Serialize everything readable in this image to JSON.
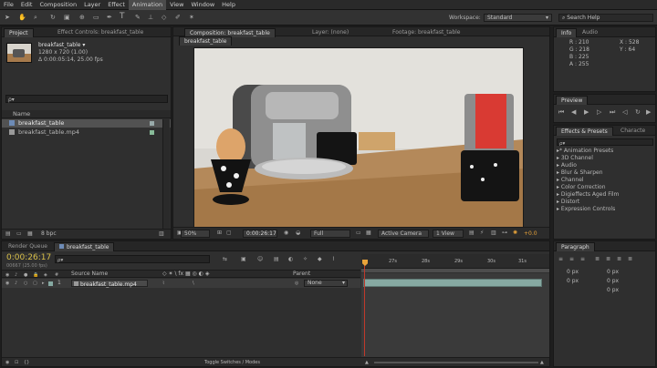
{
  "menu": {
    "items": [
      "File",
      "Edit",
      "Composition",
      "Layer",
      "Effect",
      "Animation",
      "View",
      "Window",
      "Help"
    ],
    "hover_index": 5
  },
  "toolbar": {
    "workspace_label": "Workspace:",
    "workspace_value": "Standard",
    "search_placeholder": "Search Help"
  },
  "project": {
    "tab_project": "Project",
    "tab_effect_controls": "Effect Controls: breakfast_table",
    "preview_name": "breakfast_table ▾",
    "preview_size": "1280 x 720 (1.00)",
    "preview_duration": "Δ 0:00:05:14, 25.00 fps",
    "col_name": "Name",
    "items": [
      {
        "name": "breakfast_table",
        "selected": true
      },
      {
        "name": "breakfast_table.mp4",
        "selected": false
      }
    ],
    "bpc": "8 bpc"
  },
  "composition": {
    "tab_comp": "Composition: breakfast_table",
    "tab_layer": "Layer: (none)",
    "tab_footage": "Footage: breakfast_table",
    "sub_tab": "breakfast_table",
    "zoom": "50%",
    "timecode": "0:00:26:17",
    "resolution": "Full",
    "camera": "Active Camera",
    "views": "1 View",
    "exposure": "+0.0"
  },
  "info": {
    "tab_info": "Info",
    "tab_audio": "Audio",
    "r": "R : 210",
    "g": "G : 218",
    "b": "B : 225",
    "a": "A : 255",
    "x": "X : 528",
    "y": "Y : 64"
  },
  "preview": {
    "tab": "Preview"
  },
  "effects": {
    "tab": "Effects & Presets",
    "tab2": "Characte",
    "search_placeholder": "ρ▾",
    "items": [
      "* Animation Presets",
      "3D Channel",
      "Audio",
      "Blur & Sharpen",
      "Channel",
      "Color Correction",
      "Digieffects Aged Film",
      "Distort",
      "Expression Controls"
    ]
  },
  "timeline": {
    "tab_render": "Render Queue",
    "tab_comp": "breakfast_table",
    "timecode": "0:00:26:17",
    "frame_info": "00667 (25.00 fps)",
    "search_placeholder": "ρ▾",
    "col_source": "Source Name",
    "col_parent": "Parent",
    "layer_num": "1",
    "layer_name": "breakfast_table.mp4",
    "parent_value": "None",
    "ruler": [
      "27s",
      "28s",
      "29s",
      "30s",
      "31s"
    ],
    "toggle_label": "Toggle Switches / Modes",
    "playhead_fraction": 0.0
  },
  "paragraph": {
    "tab": "Paragraph",
    "fields": [
      "0 px",
      "0 px",
      "0 px",
      "0 px",
      "0 px"
    ]
  },
  "colors": {
    "accent_orange": "#e8a33a",
    "timecode_yellow": "#d9c04a",
    "layer_bar": "#86a9a2",
    "playhead_red": "#c0392b"
  }
}
